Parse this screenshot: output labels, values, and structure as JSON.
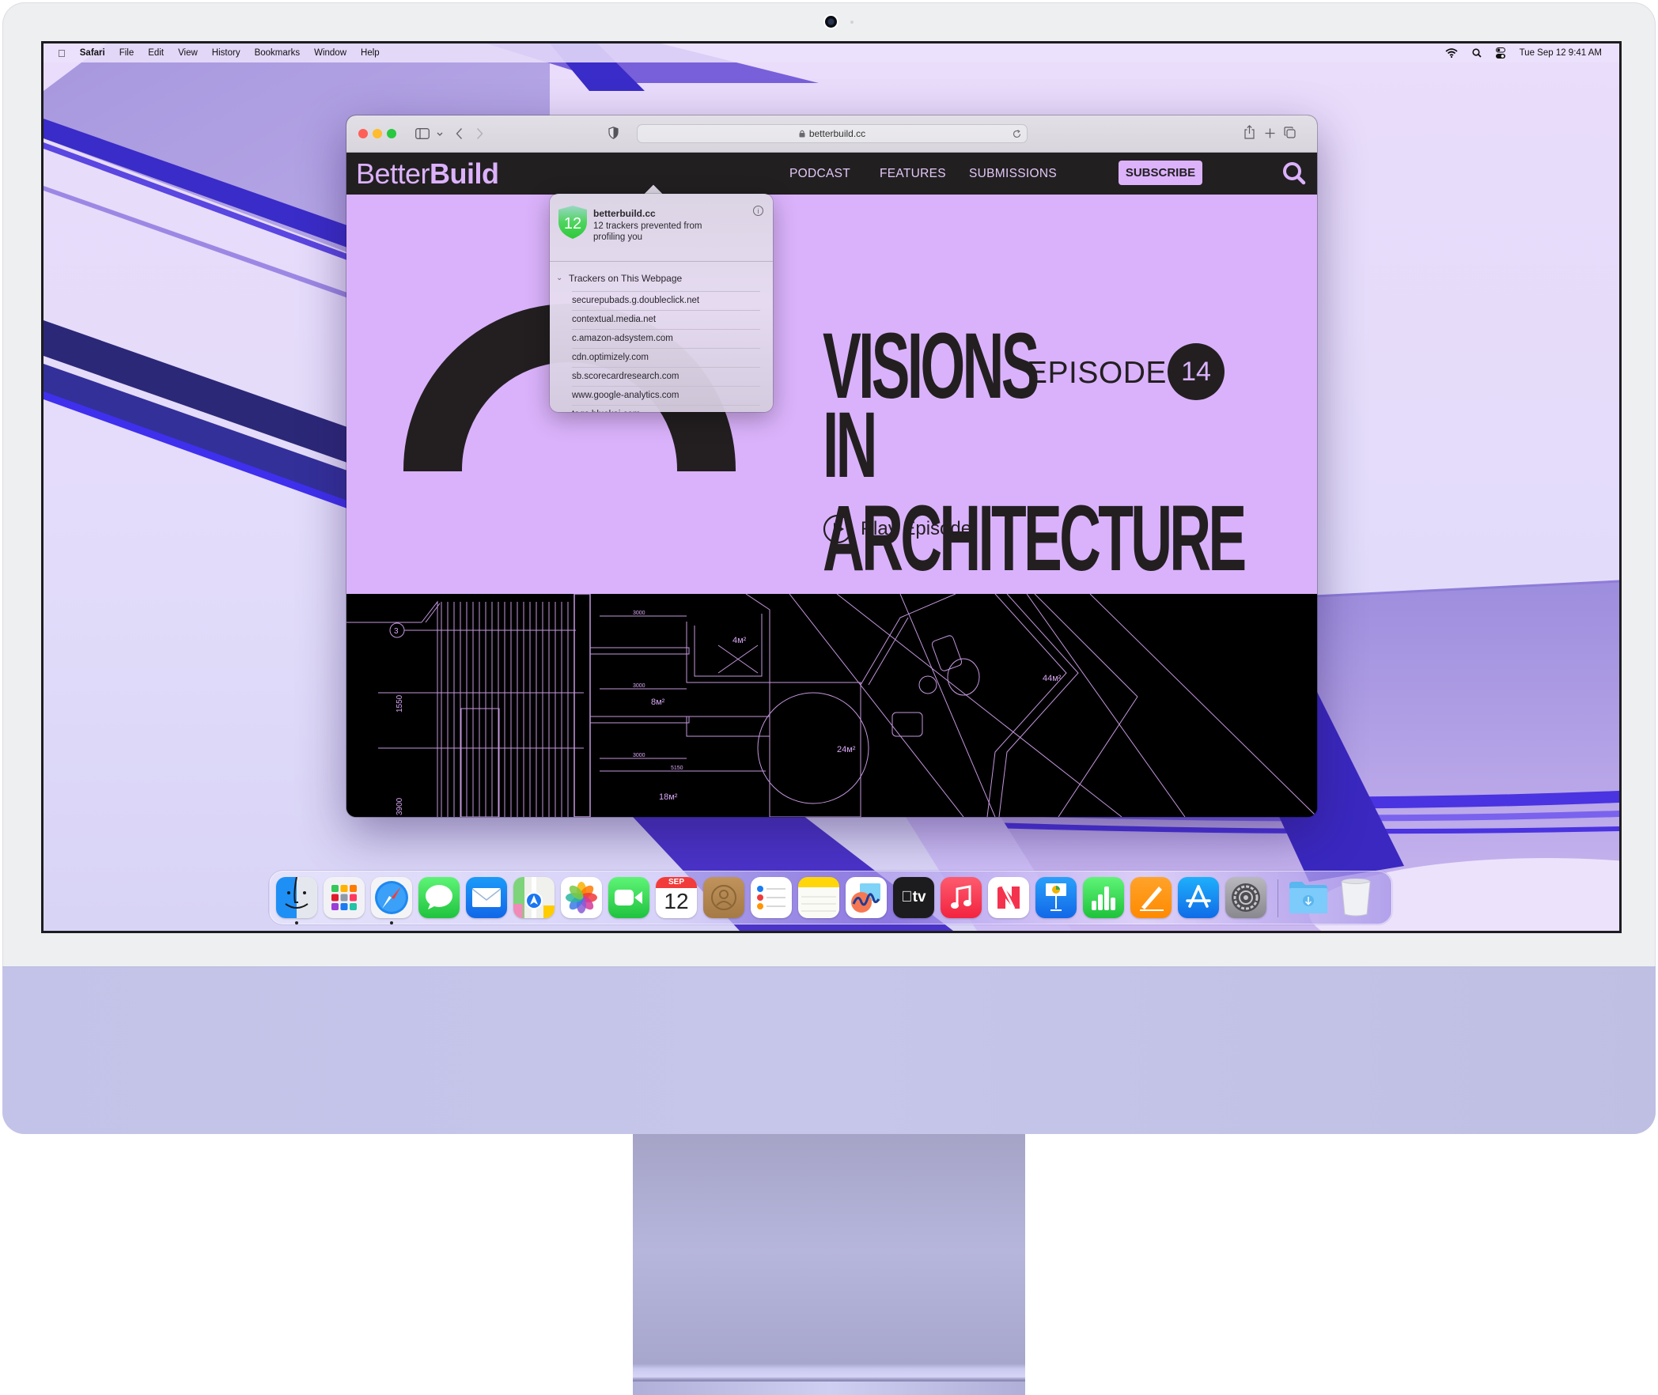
{
  "menubar": {
    "app_name": "Safari",
    "items": [
      "File",
      "Edit",
      "View",
      "History",
      "Bookmarks",
      "Window",
      "Help"
    ],
    "status_icons": [
      "wifi-icon",
      "spotlight-search-icon",
      "control-center-icon"
    ],
    "clock": "Tue Sep 12  9:41 AM"
  },
  "safari": {
    "url": "betterbuild.cc",
    "toolbar_icons": [
      "sidebar-icon",
      "chevron-down-icon",
      "back-icon",
      "forward-icon",
      "privacy-report-shield-icon",
      "lock-icon",
      "reload-icon",
      "share-icon",
      "new-tab-icon",
      "tab-overview-icon"
    ]
  },
  "site": {
    "logo_light": "Better",
    "logo_bold": "Build",
    "nav": [
      "PODCAST",
      "FEATURES",
      "SUBMISSIONS"
    ],
    "subscribe_label": "SUBSCRIBE",
    "accent_color": "#dab2fb",
    "dark_color": "#231f21",
    "hero": {
      "title_line1": "VISIONS",
      "title_line2": "IN ARCHITECTURE",
      "episode_label": "EPISODE",
      "episode_number": "14",
      "play_label": "Play Episode"
    },
    "blueprint_labels": [
      "3",
      "1550",
      "3900",
      "3000",
      "3000",
      "3000",
      "5150",
      "4м²",
      "8м²",
      "18м²",
      "24м²",
      "44м²"
    ]
  },
  "privacy_popover": {
    "tracker_count": "12",
    "site": "betterbuild.cc",
    "summary": "12 trackers prevented from profiling you",
    "section_heading": "Trackers on This Webpage",
    "trackers": [
      "securepubads.g.doubleclick.net",
      "contextual.media.net",
      "c.amazon-adsystem.com",
      "cdn.optimizely.com",
      "sb.scorecardresearch.com",
      "www.google-analytics.com",
      "tags.bluekai.com"
    ]
  },
  "dock": {
    "apps": [
      {
        "name": "Finder",
        "running": true
      },
      {
        "name": "Launchpad",
        "running": false
      },
      {
        "name": "Safari",
        "running": true
      },
      {
        "name": "Messages",
        "running": false
      },
      {
        "name": "Mail",
        "running": false
      },
      {
        "name": "Maps",
        "running": false
      },
      {
        "name": "Photos",
        "running": false
      },
      {
        "name": "FaceTime",
        "running": false
      },
      {
        "name": "Calendar",
        "running": false,
        "month": "SEP",
        "day": "12"
      },
      {
        "name": "Contacts",
        "running": false
      },
      {
        "name": "Reminders",
        "running": false
      },
      {
        "name": "Notes",
        "running": false
      },
      {
        "name": "Freeform",
        "running": false
      },
      {
        "name": "TV",
        "running": false,
        "label": "tv"
      },
      {
        "name": "Music",
        "running": false
      },
      {
        "name": "News",
        "running": false
      },
      {
        "name": "Keynote",
        "running": false
      },
      {
        "name": "Numbers",
        "running": false
      },
      {
        "name": "Pages",
        "running": false
      },
      {
        "name": "App Store",
        "running": false
      },
      {
        "name": "System Settings",
        "running": false
      }
    ],
    "extras": [
      "Downloads",
      "Trash"
    ]
  }
}
